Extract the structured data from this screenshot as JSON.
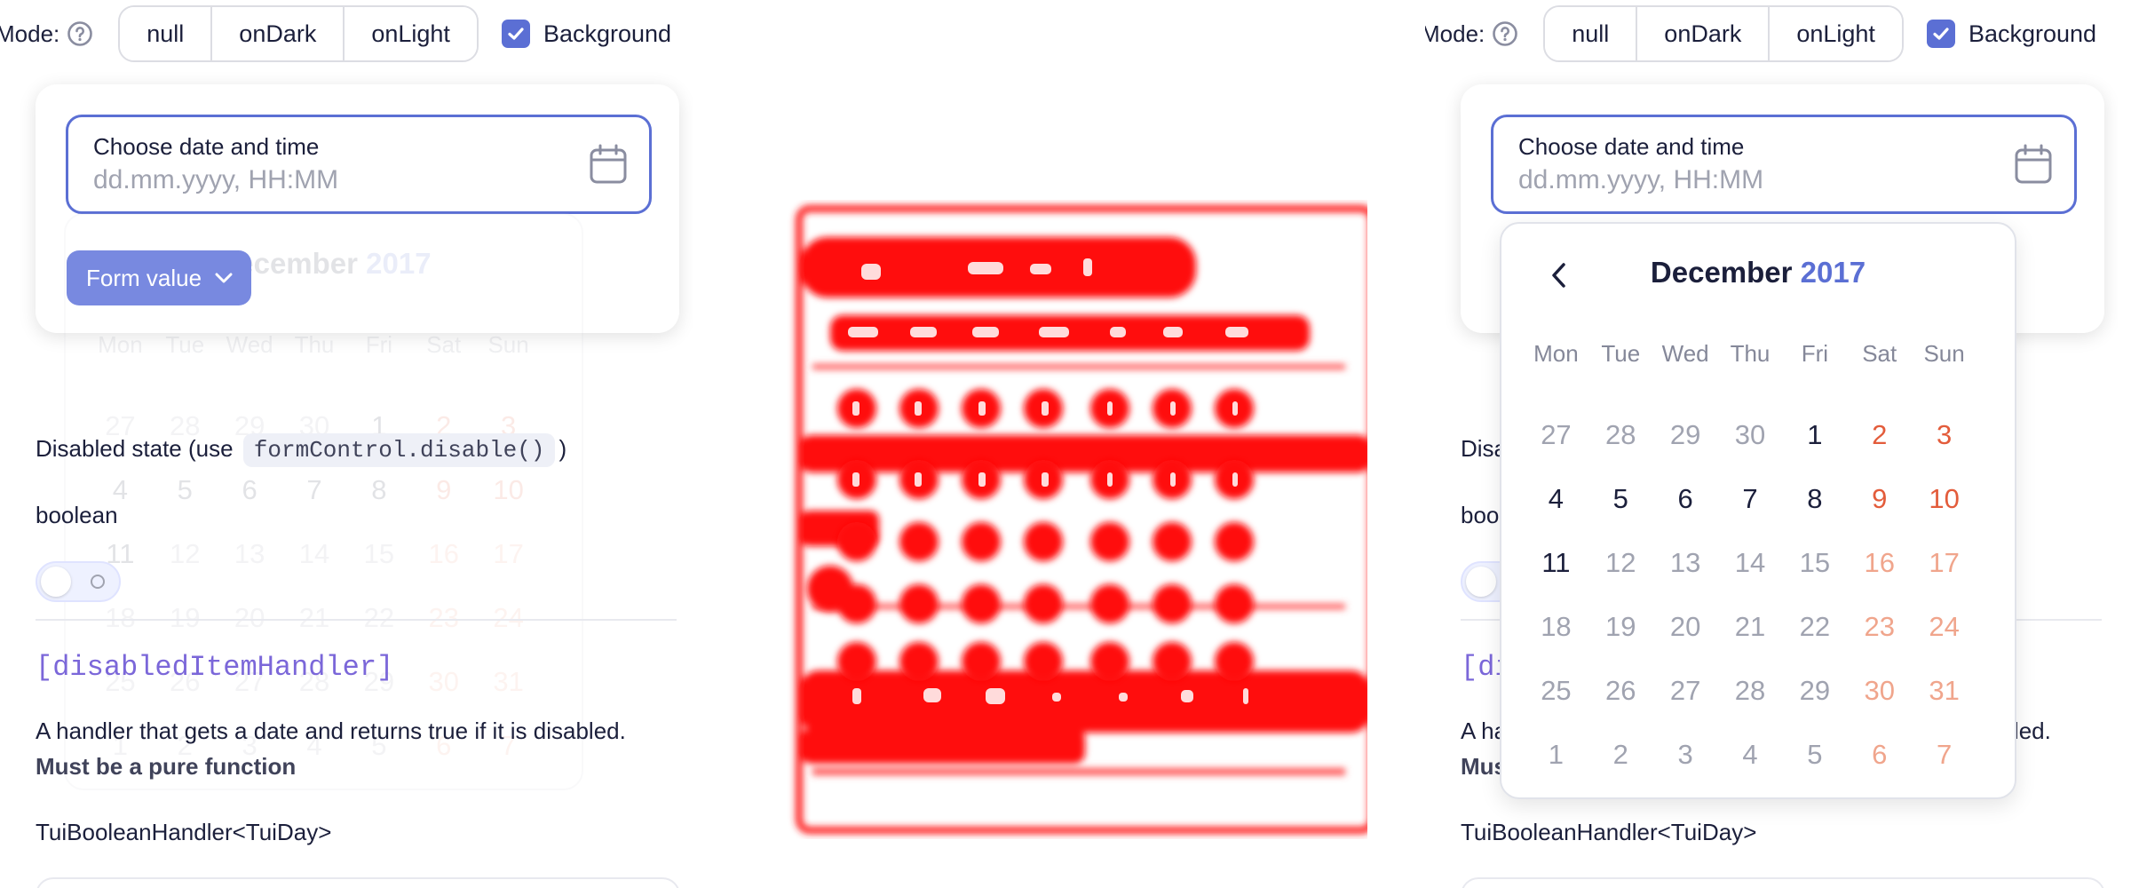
{
  "toolbar": {
    "mode_label": "Mode:",
    "mode_options": [
      "null",
      "onDark",
      "onLight"
    ],
    "background_label": "Background",
    "background_checked": true
  },
  "field": {
    "label": "Choose date and time",
    "placeholder": "dd.mm.yyyy, HH:MM"
  },
  "form_value_label": "Form value",
  "calendar": {
    "month": "December",
    "year": "2017",
    "weekdays": [
      "Mon",
      "Tue",
      "Wed",
      "Thu",
      "Fri",
      "Sat",
      "Sun"
    ],
    "weeks": [
      [
        "27",
        "28",
        "29",
        "30",
        "1",
        "2",
        "3"
      ],
      [
        "4",
        "5",
        "6",
        "7",
        "8",
        "9",
        "10"
      ],
      [
        "11",
        "12",
        "13",
        "14",
        "15",
        "16",
        "17"
      ],
      [
        "18",
        "19",
        "20",
        "21",
        "22",
        "23",
        "24"
      ],
      [
        "25",
        "26",
        "27",
        "28",
        "29",
        "30",
        "31"
      ],
      [
        "1",
        "2",
        "3",
        "4",
        "5",
        "6",
        "7"
      ]
    ]
  },
  "docs": {
    "disabled_prefix": "Disabled state (use",
    "disabled_code": "formControl.disable()",
    "disabled_suffix": ")",
    "boolean_label": "boolean",
    "prop_name": "[disabledItemHandler]",
    "prop_desc": "A handler that gets a date and returns true if it is disabled.",
    "prop_desc_bold": "Must be a pure function",
    "prop_type": "TuiBooleanHandler<TuiDay>"
  },
  "colors": {
    "accent": "#5b6fd4",
    "weekend": "#e35c3b",
    "glitch": "#ff0000"
  }
}
